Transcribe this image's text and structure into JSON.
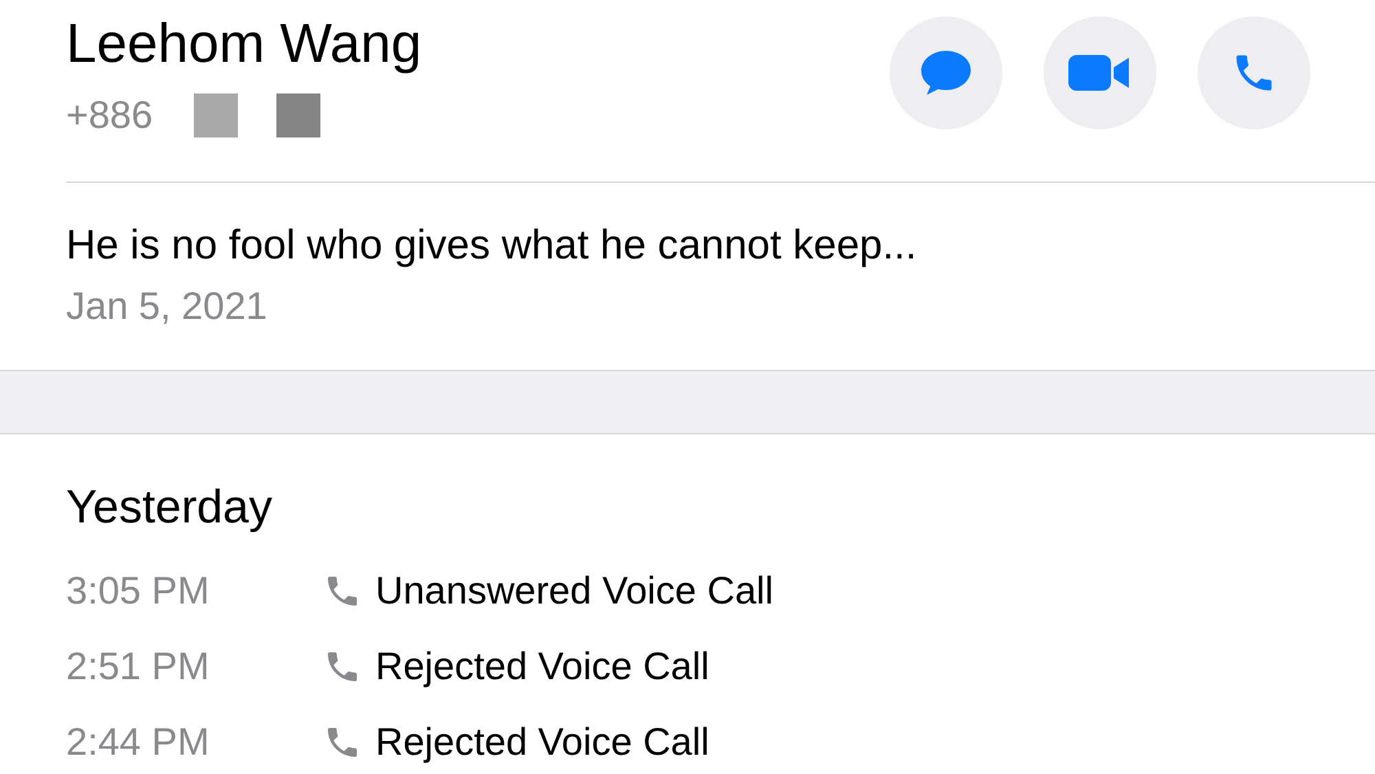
{
  "contact": {
    "name": "Leehom Wang",
    "phone": "+886",
    "redactions": [
      {
        "color": "#a9a9a9"
      },
      {
        "color": "#858585"
      }
    ]
  },
  "actions": [
    {
      "kind": "message"
    },
    {
      "kind": "video"
    },
    {
      "kind": "call"
    }
  ],
  "status": {
    "text": "He is no fool who gives what he cannot keep...",
    "date": "Jan 5, 2021"
  },
  "history": {
    "heading": "Yesterday",
    "calls": [
      {
        "time": "3:05 PM",
        "label": "Unanswered Voice Call"
      },
      {
        "time": "2:51 PM",
        "label": "Rejected Voice Call"
      },
      {
        "time": "2:44 PM",
        "label": "Rejected Voice Call"
      }
    ]
  }
}
